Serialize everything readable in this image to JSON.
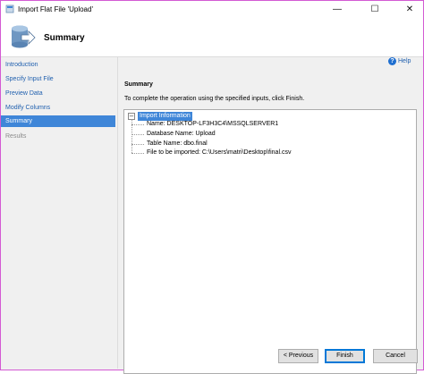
{
  "window": {
    "title": "Import Flat File 'Upload'",
    "minimize_glyph": "—",
    "maximize_glyph": "☐",
    "close_glyph": "✕"
  },
  "header": {
    "title": "Summary"
  },
  "sidebar": {
    "items": [
      {
        "label": "Introduction",
        "state": "link"
      },
      {
        "label": "Specify Input File",
        "state": "link"
      },
      {
        "label": "Preview Data",
        "state": "link"
      },
      {
        "label": "Modify Columns",
        "state": "link"
      },
      {
        "label": "Summary",
        "state": "active"
      },
      {
        "label": "Results",
        "state": "disabled"
      }
    ]
  },
  "main": {
    "help_label": "Help",
    "section_title": "Summary",
    "instruction": "To complete the operation using the specified inputs, click Finish.",
    "tree": {
      "toggle": "−",
      "root_label": "Import Information",
      "children": [
        "Name: DESKTOP-LF3H3C4\\MSSQLSERVER1",
        "Database Name: Upload",
        "Table Name: dbo.final",
        "File to be imported: C:\\Users\\matri\\Desktop\\final.csv"
      ]
    }
  },
  "footer": {
    "previous_label": "< Previous",
    "finish_label": "Finish",
    "cancel_label": "Cancel"
  },
  "colors": {
    "accent": "#3f86d8",
    "link": "#1f5fae",
    "window_border": "#d35ad3"
  }
}
